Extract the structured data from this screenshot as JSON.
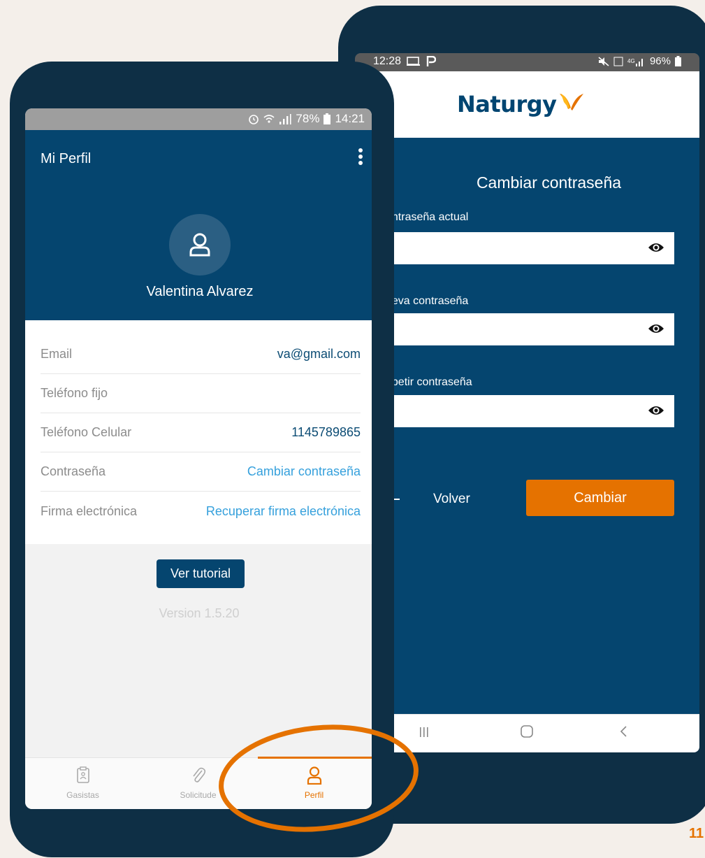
{
  "back_phone": {
    "status": {
      "time": "12:28",
      "battery": "96%"
    },
    "brand": "Naturgy",
    "title": "Cambiar contraseña",
    "fields": [
      {
        "label": "ontraseña actual"
      },
      {
        "label": "ueva contraseña"
      },
      {
        "label": "epetir contraseña"
      }
    ],
    "back_label": "Volver",
    "submit_label": "Cambiar",
    "colors": {
      "primary": "#05456f",
      "accent": "#e57200"
    }
  },
  "front_phone": {
    "status": {
      "battery": "78%",
      "time": "14:21"
    },
    "title": "Mi Perfil",
    "user_name": "Valentina Alvarez",
    "rows": [
      {
        "key": "Email",
        "value": "va@gmail.com"
      },
      {
        "key": "Teléfono fijo",
        "value": ""
      },
      {
        "key": "Teléfono Celular",
        "value": "1145789865"
      },
      {
        "key": "Contraseña",
        "value": "Cambiar contraseña"
      },
      {
        "key": "Firma electrónica",
        "value": "Recuperar firma electrónica"
      }
    ],
    "tutorial_label": "Ver tutorial",
    "version": "Version 1.5.20",
    "tabs": [
      {
        "label": "Gasistas",
        "icon": "clipboard-icon"
      },
      {
        "label": "Solicitude",
        "icon": "paperclip-icon"
      },
      {
        "label": "Perfil",
        "icon": "user-icon",
        "active": true
      }
    ]
  },
  "page_number": "11"
}
